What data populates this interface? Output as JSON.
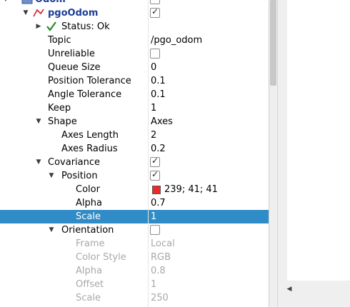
{
  "display_root": {
    "name": "Odom",
    "checked": true
  },
  "display": {
    "name": "pgoOdom",
    "checked": true
  },
  "status": {
    "name": "Status: Ok"
  },
  "properties": {
    "topic": {
      "name": "Topic",
      "value": "/pgo_odom"
    },
    "unreliable": {
      "name": "Unreliable",
      "checked": false
    },
    "queue_size": {
      "name": "Queue Size",
      "value": "0"
    },
    "position_tolerance": {
      "name": "Position Tolerance",
      "value": "0.1"
    },
    "angle_tolerance": {
      "name": "Angle Tolerance",
      "value": "0.1"
    },
    "keep": {
      "name": "Keep",
      "value": "1"
    },
    "shape": {
      "name": "Shape",
      "value": "Axes"
    },
    "axes_length": {
      "name": "Axes Length",
      "value": "2"
    },
    "axes_radius": {
      "name": "Axes Radius",
      "value": "0.2"
    },
    "covariance": {
      "name": "Covariance",
      "checked": true
    },
    "cov_position": {
      "name": "Position",
      "checked": true
    },
    "pos_color": {
      "name": "Color",
      "value": "239; 41; 41",
      "swatch": "#ef2929"
    },
    "pos_alpha": {
      "name": "Alpha",
      "value": "0.7"
    },
    "pos_scale": {
      "name": "Scale",
      "value": "1"
    },
    "cov_orientation": {
      "name": "Orientation",
      "checked": false
    },
    "ori_frame": {
      "name": "Frame",
      "value": "Local"
    },
    "ori_color_style": {
      "name": "Color Style",
      "value": "RGB"
    },
    "ori_alpha": {
      "name": "Alpha",
      "value": "0.8"
    },
    "ori_offset": {
      "name": "Offset",
      "value": "1"
    },
    "ori_scale": {
      "name": "Scale",
      "value": "250"
    }
  },
  "colors": {
    "selection": "#308cc6",
    "display_name": "#1c3f95",
    "disabled": "#a8a8a8"
  },
  "icons": {
    "root": "display-folder-icon",
    "display": "odometry-icon",
    "status": "check-ok-icon"
  }
}
